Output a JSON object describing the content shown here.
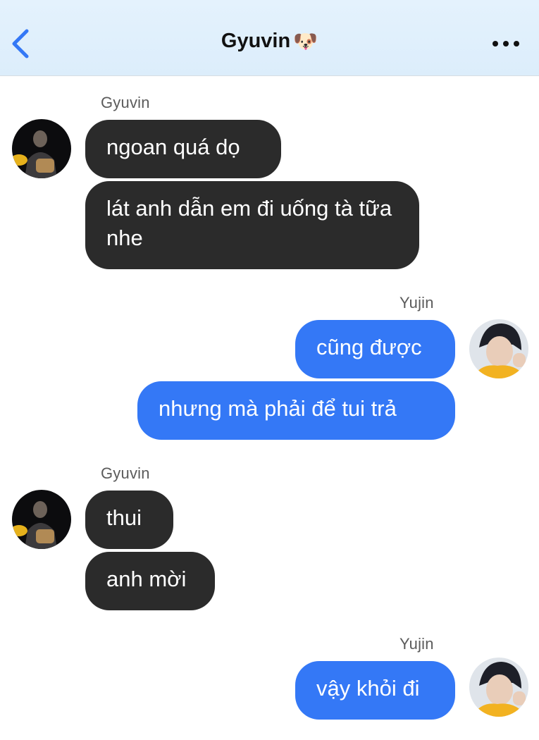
{
  "header": {
    "title": "Gyuvin",
    "title_emoji": "🐶",
    "back_icon": "chevron-left-icon",
    "more_icon": "more-horizontal-icon"
  },
  "colors": {
    "accent": "#3478f6",
    "incoming_bubble": "#2b2b2b",
    "outgoing_bubble": "#3478f6",
    "header_bg": "#e4f2fd"
  },
  "messages": [
    {
      "sender": "Gyuvin",
      "items": [
        "ngoan quá dọ",
        "lát anh dẫn em đi uống tà tữa nhe"
      ]
    },
    {
      "sender": "Yujin",
      "items": [
        "cũng được",
        "nhưng mà phải để tui trả"
      ]
    },
    {
      "sender": "Gyuvin",
      "items": [
        "thui",
        "anh mời"
      ]
    },
    {
      "sender": "Yujin",
      "items": [
        "vậy khỏi đi"
      ]
    }
  ]
}
